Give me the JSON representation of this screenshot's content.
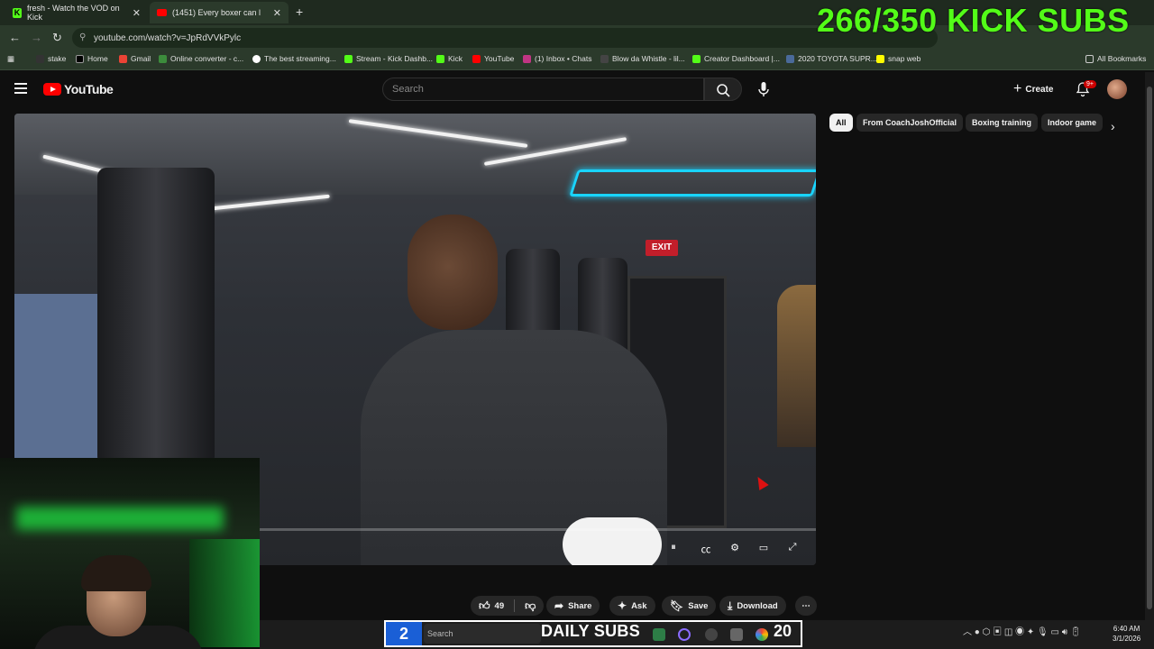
{
  "browser": {
    "tabs": [
      {
        "title": "fresh - Watch the VOD on Kick",
        "favicon": "kick-icon"
      },
      {
        "title": "(1451) Every boxer can lear",
        "favicon": "youtube-icon"
      }
    ],
    "url": "youtube.com/watch?v=JpRdVVkPylc",
    "bookmarks": [
      "stake",
      "Home",
      "Gmail",
      "Online converter - c...",
      "The best streaming...",
      "Stream - Kick Dashb...",
      "Kick",
      "YouTube",
      "(1) Inbox • Chats",
      "Blow da Whistle - lil...",
      "Creator Dashboard |...",
      "2020 TOYOTA SUPR...",
      "snap web"
    ],
    "all_bookmarks": "All Bookmarks"
  },
  "overlay": {
    "subs_goal": "266/350 KICK SUBS"
  },
  "youtube": {
    "logo_text": "YouTube",
    "search_placeholder": "Search",
    "create_label": "Create",
    "notif_badge": "9+"
  },
  "video": {
    "exit_sign": "EXIT",
    "progress_fraction": 0.0
  },
  "chips": [
    "All",
    "From CoachJoshOfficial",
    "Boxing training",
    "Indoor game"
  ],
  "actions": {
    "like_count": "49",
    "share": "Share",
    "ask": "Ask",
    "save": "Save",
    "download": "Download"
  },
  "taskbar": {
    "daily_left": "2",
    "search": "Search",
    "daily_label": "DAILY SUBS",
    "daily_right": "20",
    "time": "6:40 AM",
    "date": "3/1/2026"
  },
  "colors": {
    "kick_green": "#53fc18",
    "youtube_red": "#ff0000",
    "neon_cyan": "#19d4ff"
  }
}
